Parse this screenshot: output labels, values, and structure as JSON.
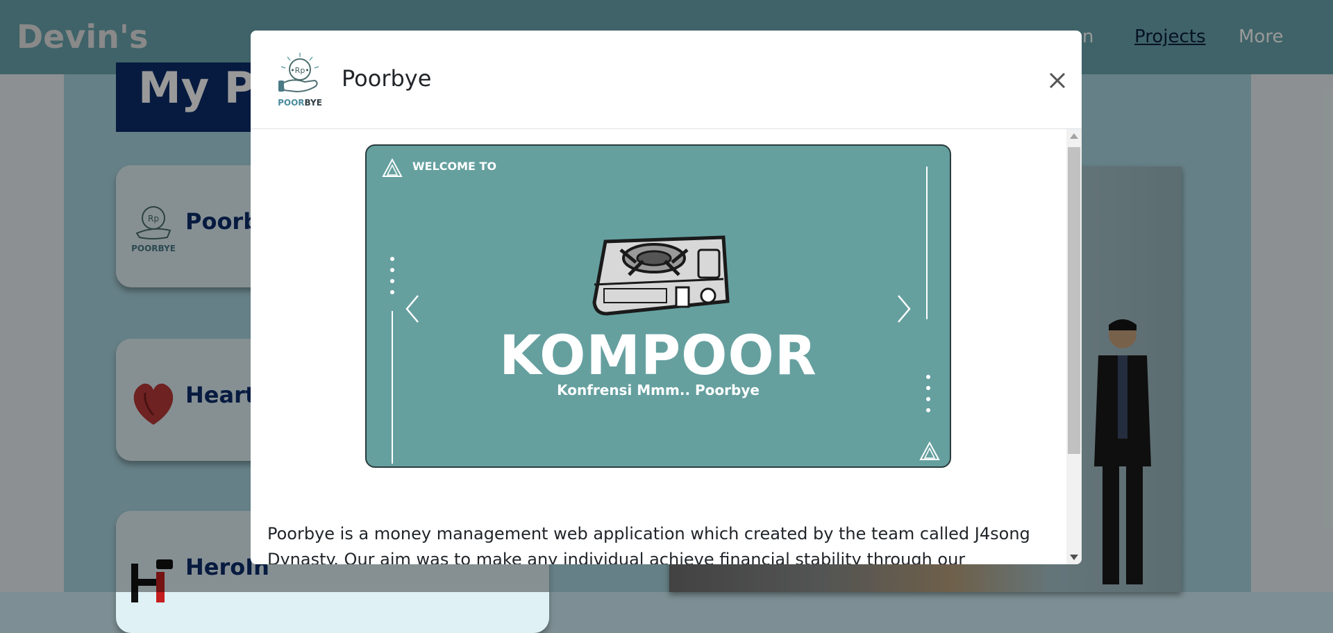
{
  "nav": {
    "brand": "Devin's",
    "partial_link": "on",
    "projects": "Projects",
    "more": "More"
  },
  "section_title": "My Pr",
  "project_cards": [
    {
      "name": "Poorb"
    },
    {
      "name": "Heart"
    },
    {
      "name": "HeroIn"
    }
  ],
  "modal": {
    "title": "Poorbye",
    "logo_text_poor": "POOR",
    "logo_text_bye": "BYE",
    "logo_coin": "•Rp•",
    "slide": {
      "welcome": "WELCOME TO",
      "heading": "KOMPOOR",
      "subheading": "Konfrensi Mmm.. Poorbye"
    },
    "description": "Poorbye is a money management web application which created by the team called J4song Dynasty. Our aim was to make any individual achieve financial stability through our prepared"
  },
  "colors": {
    "navbar": "#6aa6ae",
    "slide_bg": "#65a09f",
    "title_bg": "#0d2e6b",
    "accent_text": "#0d2e6b"
  },
  "icons": [
    "poorbye-logo-icon",
    "close-icon",
    "chevron-left-icon",
    "chevron-right-icon",
    "stove-icon",
    "triangle-logo-icon",
    "heart-icon",
    "heroin-logo-icon"
  ]
}
